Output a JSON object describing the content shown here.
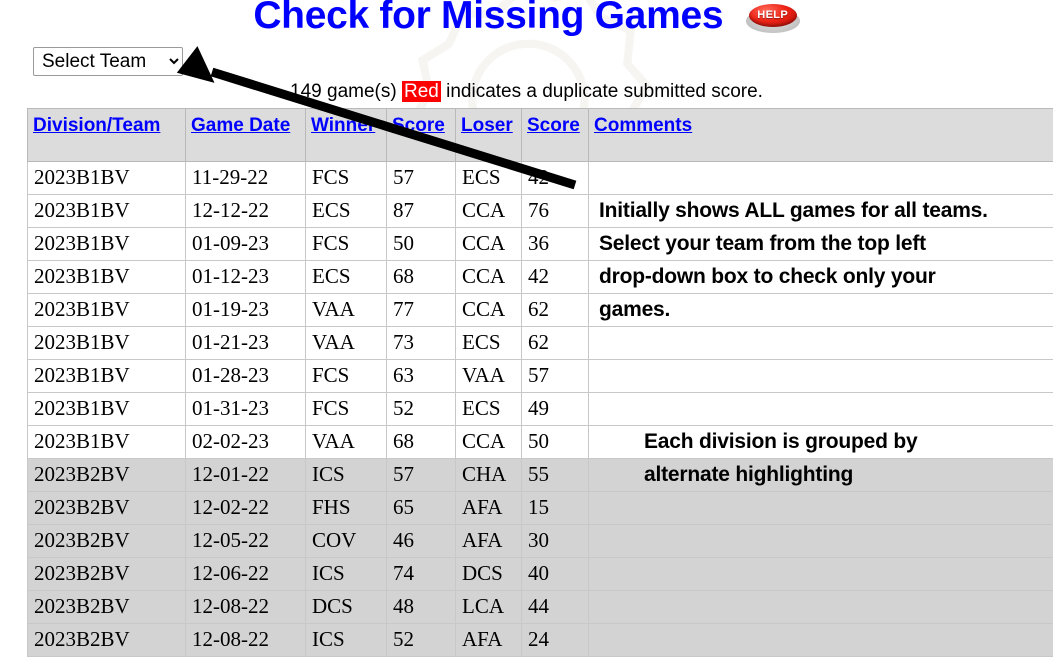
{
  "header": {
    "title": "Check for Missing Games",
    "help_label": "HELP"
  },
  "toolbar": {
    "team_select_value": "Select Team",
    "team_select_options": [
      "Select Team"
    ]
  },
  "subtitle": {
    "count_text": "149 game(s)",
    "red_tag": "Red",
    "tail_text": "indicates a duplicate submitted score."
  },
  "table": {
    "columns": [
      "Division/Team",
      "Game Date",
      "Winner",
      "Score",
      "Loser",
      "Score",
      "Comments"
    ],
    "rows": [
      {
        "division": "2023B1BV",
        "date": "11-29-22",
        "winner": "FCS",
        "wscore": "57",
        "loser": "ECS",
        "lscore": "42",
        "comment": "",
        "group": "grp-a",
        "indent": false
      },
      {
        "division": "2023B1BV",
        "date": "12-12-22",
        "winner": "ECS",
        "wscore": "87",
        "loser": "CCA",
        "lscore": "76",
        "comment": "Initially shows ALL games for all teams.",
        "group": "grp-a",
        "indent": false
      },
      {
        "division": "2023B1BV",
        "date": "01-09-23",
        "winner": "FCS",
        "wscore": "50",
        "loser": "CCA",
        "lscore": "36",
        "comment": "Select your team from the top left",
        "group": "grp-a",
        "indent": false
      },
      {
        "division": "2023B1BV",
        "date": "01-12-23",
        "winner": "ECS",
        "wscore": "68",
        "loser": "CCA",
        "lscore": "42",
        "comment": "drop-down box to check only your",
        "group": "grp-a",
        "indent": false
      },
      {
        "division": "2023B1BV",
        "date": "01-19-23",
        "winner": "VAA",
        "wscore": "77",
        "loser": "CCA",
        "lscore": "62",
        "comment": "games.",
        "group": "grp-a",
        "indent": false
      },
      {
        "division": "2023B1BV",
        "date": "01-21-23",
        "winner": "VAA",
        "wscore": "73",
        "loser": "ECS",
        "lscore": "62",
        "comment": "",
        "group": "grp-a",
        "indent": false
      },
      {
        "division": "2023B1BV",
        "date": "01-28-23",
        "winner": "FCS",
        "wscore": "63",
        "loser": "VAA",
        "lscore": "57",
        "comment": "",
        "group": "grp-a",
        "indent": false
      },
      {
        "division": "2023B1BV",
        "date": "01-31-23",
        "winner": "FCS",
        "wscore": "52",
        "loser": "ECS",
        "lscore": "49",
        "comment": "",
        "group": "grp-a",
        "indent": false
      },
      {
        "division": "2023B1BV",
        "date": "02-02-23",
        "winner": "VAA",
        "wscore": "68",
        "loser": "CCA",
        "lscore": "50",
        "comment": "Each division is grouped by",
        "group": "grp-a",
        "indent": true
      },
      {
        "division": "2023B2BV",
        "date": "12-01-22",
        "winner": "ICS",
        "wscore": "57",
        "loser": "CHA",
        "lscore": "55",
        "comment": "alternate highlighting",
        "group": "grp-b",
        "indent": true
      },
      {
        "division": "2023B2BV",
        "date": "12-02-22",
        "winner": "FHS",
        "wscore": "65",
        "loser": "AFA",
        "lscore": "15",
        "comment": "",
        "group": "grp-b",
        "indent": false
      },
      {
        "division": "2023B2BV",
        "date": "12-05-22",
        "winner": "COV",
        "wscore": "46",
        "loser": "AFA",
        "lscore": "30",
        "comment": "",
        "group": "grp-b",
        "indent": false
      },
      {
        "division": "2023B2BV",
        "date": "12-06-22",
        "winner": "ICS",
        "wscore": "74",
        "loser": "DCS",
        "lscore": "40",
        "comment": "",
        "group": "grp-b",
        "indent": false
      },
      {
        "division": "2023B2BV",
        "date": "12-08-22",
        "winner": "DCS",
        "wscore": "48",
        "loser": "LCA",
        "lscore": "44",
        "comment": "",
        "group": "grp-b",
        "indent": false
      },
      {
        "division": "2023B2BV",
        "date": "12-08-22",
        "winner": "ICS",
        "wscore": "52",
        "loser": "AFA",
        "lscore": "24",
        "comment": "",
        "group": "grp-b",
        "indent": false
      }
    ]
  },
  "colors": {
    "title": "#0000ff",
    "link": "#0000ff",
    "duplicate_highlight": "#ff0000",
    "header_bg": "#dcdcdc",
    "alt_row_bg": "#d3d3d3"
  }
}
